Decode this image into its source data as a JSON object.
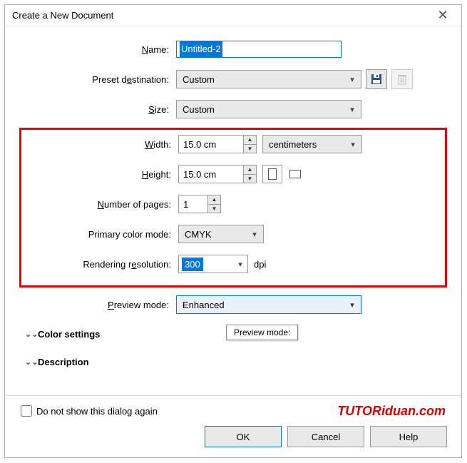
{
  "titlebar": {
    "title": "Create a New Document"
  },
  "labels": {
    "name": "ame:",
    "preset": "estination:",
    "size": "ize:",
    "width": "idth:",
    "height": "eight:",
    "pages": "umber of pages:",
    "colormode": "Primary color mode:",
    "resolution": "esolution:",
    "preview": "review mode:"
  },
  "prefix": {
    "name": "N",
    "preset": "Preset d",
    "size": "S",
    "width": "W",
    "height": "H",
    "pages": "N",
    "resolution": "Rendering r",
    "preview": "P"
  },
  "values": {
    "name": "Untitled-2",
    "preset": "Custom",
    "size": "Custom",
    "width": "15.0 cm",
    "height": "15.0 cm",
    "units": "centimeters",
    "pages": "1",
    "colormode": "CMYK",
    "resolution": "300",
    "resolution_unit": "dpi",
    "preview": "Enhanced"
  },
  "sections": {
    "color": "Color settings",
    "description": "Description"
  },
  "tooltip": "Preview mode:",
  "bottom": {
    "checkbox": "Do not show this dialog again",
    "watermark": "TUTORiduan.com"
  },
  "buttons": {
    "ok": "OK",
    "cancel": "Cancel",
    "help": "Help"
  }
}
